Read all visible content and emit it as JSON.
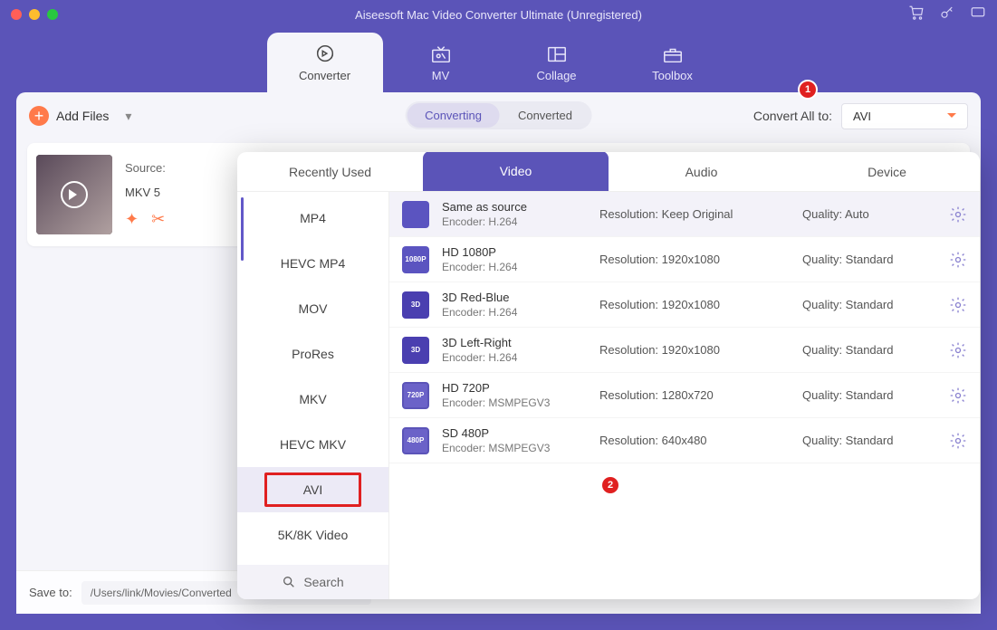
{
  "title": "Aiseesoft Mac Video Converter Ultimate (Unregistered)",
  "appTabs": {
    "converter": "Converter",
    "mv": "MV",
    "collage": "Collage",
    "toolbox": "Toolbox"
  },
  "toolbar": {
    "addFiles": "Add Files",
    "converting": "Converting",
    "converted": "Converted",
    "convertAllTo": "Convert All to:",
    "selectedFormat": "AVI"
  },
  "fileRow": {
    "sourceLabel": "Source:",
    "fmt": "MKV   5"
  },
  "bottom": {
    "saveTo": "Save to:",
    "path": "/Users/link/Movies/Converted"
  },
  "panel": {
    "tabs": {
      "recent": "Recently Used",
      "video": "Video",
      "audio": "Audio",
      "device": "Device"
    },
    "formats": [
      "MP4",
      "HEVC MP4",
      "MOV",
      "ProRes",
      "MKV",
      "HEVC MKV",
      "AVI",
      "5K/8K Video"
    ],
    "searchLabel": "Search",
    "labels": {
      "res": "Resolution:",
      "enc": "Encoder:",
      "q": "Quality:"
    },
    "profiles": [
      {
        "title": "Same as source",
        "encoder": "H.264",
        "resolution": "Keep Original",
        "quality": "Auto",
        "iconText": ""
      },
      {
        "title": "HD 1080P",
        "encoder": "H.264",
        "resolution": "1920x1080",
        "quality": "Standard",
        "iconText": "1080P"
      },
      {
        "title": "3D Red-Blue",
        "encoder": "H.264",
        "resolution": "1920x1080",
        "quality": "Standard",
        "iconText": "3D"
      },
      {
        "title": "3D Left-Right",
        "encoder": "H.264",
        "resolution": "1920x1080",
        "quality": "Standard",
        "iconText": "3D"
      },
      {
        "title": "HD 720P",
        "encoder": "MSMPEGV3",
        "resolution": "1280x720",
        "quality": "Standard",
        "iconText": "720P"
      },
      {
        "title": "SD 480P",
        "encoder": "MSMPEGV3",
        "resolution": "640x480",
        "quality": "Standard",
        "iconText": "480P"
      }
    ]
  },
  "callouts": {
    "one": "1",
    "two": "2"
  }
}
